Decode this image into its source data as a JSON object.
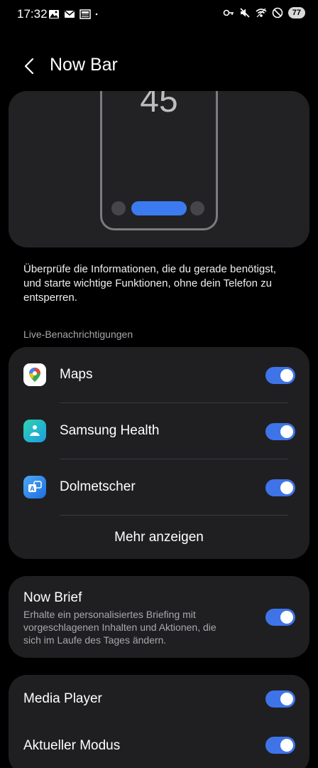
{
  "status_bar": {
    "time": "17:32",
    "battery": "77",
    "left_icons": [
      "gallery-icon",
      "mail-icon",
      "news-icon",
      "dot-icon"
    ],
    "right_icons": [
      "key-icon",
      "mute-icon",
      "wifi-icon",
      "do-not-disturb-icon"
    ]
  },
  "header": {
    "title": "Now Bar"
  },
  "preview": {
    "clock": "45"
  },
  "description": "Überprüfe die Informationen, die du gerade benötigst, und starte wichtige Funktionen, ohne dein Telefon zu entsperren.",
  "live_section": {
    "label": "Live-Benachrichtigungen",
    "apps": [
      {
        "label": "Maps",
        "icon": "maps-icon",
        "enabled": true
      },
      {
        "label": "Samsung Health",
        "icon": "samsung-health-icon",
        "enabled": true
      },
      {
        "label": "Dolmetscher",
        "icon": "interpreter-icon",
        "enabled": true
      }
    ],
    "more_label": "Mehr anzeigen"
  },
  "now_brief": {
    "title": "Now Brief",
    "description": "Erhalte ein personalisiertes Briefing mit vorgeschlagenen Inhalten und Aktionen, die sich im Laufe des Tages ändern.",
    "enabled": true
  },
  "other_settings": [
    {
      "label": "Media Player",
      "enabled": true
    },
    {
      "label": "Aktueller Modus",
      "enabled": true
    }
  ],
  "colors": {
    "accent": "#3f74e8",
    "card_background": "#1f1f22",
    "background": "#000000"
  }
}
